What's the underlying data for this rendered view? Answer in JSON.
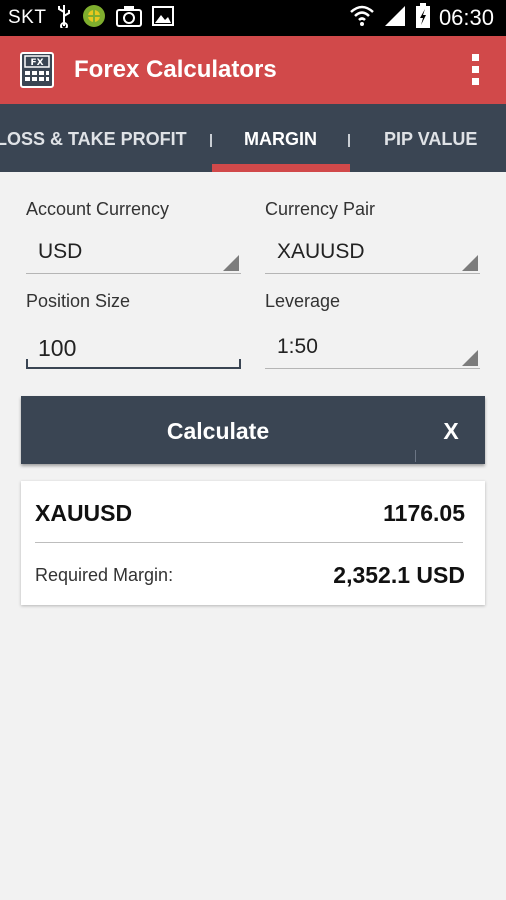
{
  "status_bar": {
    "carrier": "SKT",
    "time": "06:30",
    "icons": [
      "usb-icon",
      "bonus-app-icon",
      "camera-icon",
      "gallery-icon",
      "wifi-icon",
      "signal-icon",
      "battery-charging-icon"
    ]
  },
  "app_bar": {
    "logo_text": "FX",
    "title": "Forex Calculators",
    "menu_icon": "overflow-menu-icon"
  },
  "tabs": [
    {
      "label": "LOSS & TAKE PROFIT",
      "active": false
    },
    {
      "label": "MARGIN",
      "active": true
    },
    {
      "label": "PIP VALUE",
      "active": false
    }
  ],
  "form": {
    "account_currency": {
      "label": "Account Currency",
      "value": "USD"
    },
    "currency_pair": {
      "label": "Currency Pair",
      "value": "XAUUSD"
    },
    "position_size": {
      "label": "Position Size",
      "value": "100"
    },
    "leverage": {
      "label": "Leverage",
      "value": "1:50"
    }
  },
  "actions": {
    "calculate_label": "Calculate",
    "clear_label": "X"
  },
  "result": {
    "pair": "XAUUSD",
    "price": "1176.05",
    "margin_label": "Required Margin:",
    "margin_value": "2,352.1 USD"
  },
  "colors": {
    "accent_red": "#d1494a",
    "dark_slate": "#3a4553",
    "background": "#f2f2f2"
  }
}
